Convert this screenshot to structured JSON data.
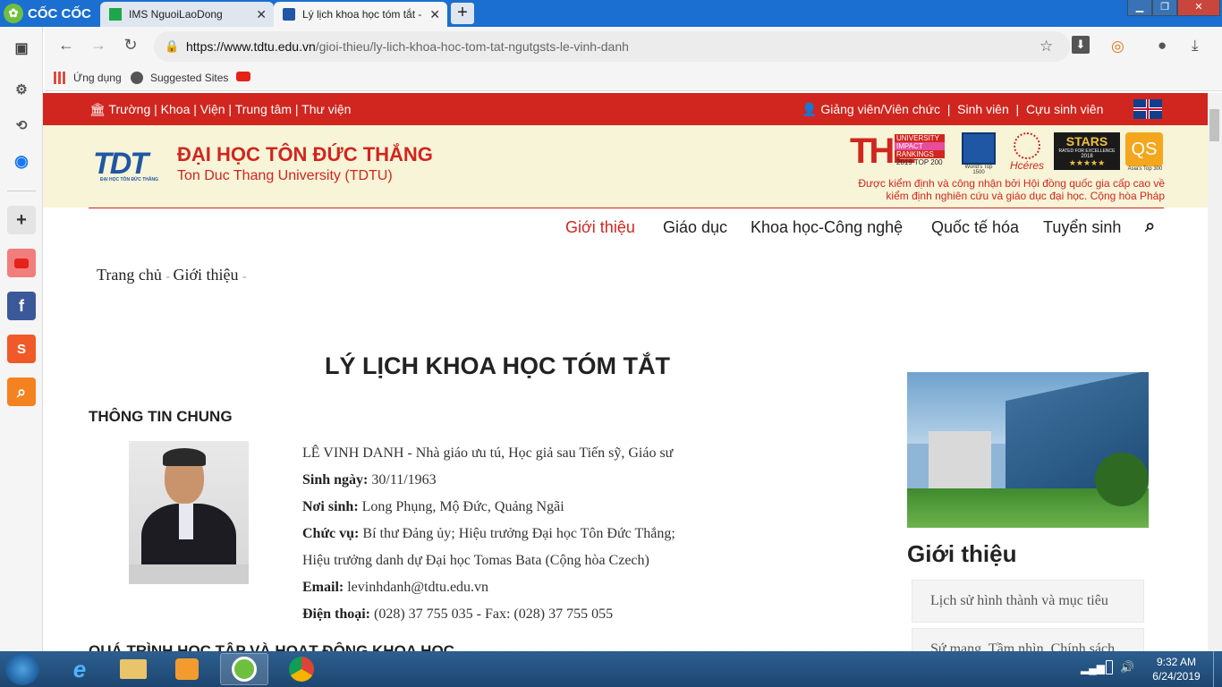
{
  "browser": {
    "brand": "CỐC CỐC",
    "tabs": [
      {
        "title": "IMS NguoiLaoDong"
      },
      {
        "title": "Lý lịch khoa học tóm tắt - "
      }
    ],
    "url_host": "https://www.tdtu.edu.vn",
    "url_path": "/gioi-thieu/ly-lich-khoa-hoc-tom-tat-ngutgsts-le-vinh-danh",
    "bookmarks": [
      "Ứng dụng",
      "Suggested Sites"
    ]
  },
  "topbar": {
    "left_links": "Trường | Khoa | Viện | Trung tâm | Thư viện",
    "right_links": "Giảng viên/Viên chức  |  Sinh viên  |  Cựu sinh viên"
  },
  "header": {
    "logo_text": "TDT",
    "logo_sub": "ĐẠI HỌC TÔN ĐỨC THẮNG",
    "name_vn": "ĐẠI HỌC TÔN ĐỨC THẮNG",
    "name_en": "Ton Duc Thang University (TDTU)",
    "badges": {
      "the": "THE",
      "the_lines": [
        "UNIVERSITY",
        "IMPACT",
        "RANKINGS",
        "2019 TOP 200"
      ],
      "world_top": "World's Top 1500",
      "hceres": "Hcéres",
      "stars": "STARS",
      "stars_sub": "RATED FOR EXCELLENCE",
      "stars_year": "2018",
      "qs": "QS",
      "qs_sub": "Asia's Top 300"
    },
    "accreditation": "Được kiểm định và công nhận bởi Hội đồng quốc gia cấp cao về kiểm định nghiên cứu và giáo dục đại học. Cộng hòa Pháp"
  },
  "nav": [
    "Giới thiệu",
    "Giáo dục",
    "Khoa học-Công nghệ",
    "Quốc tế hóa",
    "Tuyển sinh"
  ],
  "breadcrumb": [
    "Trang chủ",
    "Giới thiệu"
  ],
  "content": {
    "title": "LÝ LỊCH KHOA HỌC TÓM TẮT",
    "section_general": "THÔNG TIN CHUNG",
    "name_line": "LÊ VINH DANH - Nhà giáo ưu tú, Học giả sau Tiến sỹ, Giáo sư",
    "dob_label": "Sinh ngày:",
    "dob": " 30/11/1963",
    "pob_label": "Nơi sinh:",
    "pob": " Long Phụng, Mộ Đức, Quảng Ngãi",
    "position_label": "Chức vụ:",
    "position": " Bí thư Đảng ủy; Hiệu trưởng Đại học Tôn Đức Thắng;",
    "position2": "Hiệu trưởng danh dự Đại học Tomas Bata (Cộng hòa Czech)",
    "email_label": "Email:",
    "email": " levinhdanh@tdtu.edu.vn",
    "phone_label": "Điện thoại:",
    "phone": " (028) 37 755 035 - Fax: (028) 37 755 055",
    "section_next": "QUÁ TRÌNH HỌC TẬP VÀ HOẠT ĐỘNG KHOA HỌC"
  },
  "sidebar": {
    "title": "Giới thiệu",
    "links": [
      "Lịch sử hình thành và mục tiêu",
      "Sứ mạng, Tầm nhìn, Chính sách"
    ]
  },
  "taskbar": {
    "time": "9:32 AM",
    "date": "6/24/2019"
  },
  "colors": {
    "brand_red": "#d0261f",
    "brand_blue": "#1f57a4",
    "banner_bg": "#f8f4d7"
  }
}
